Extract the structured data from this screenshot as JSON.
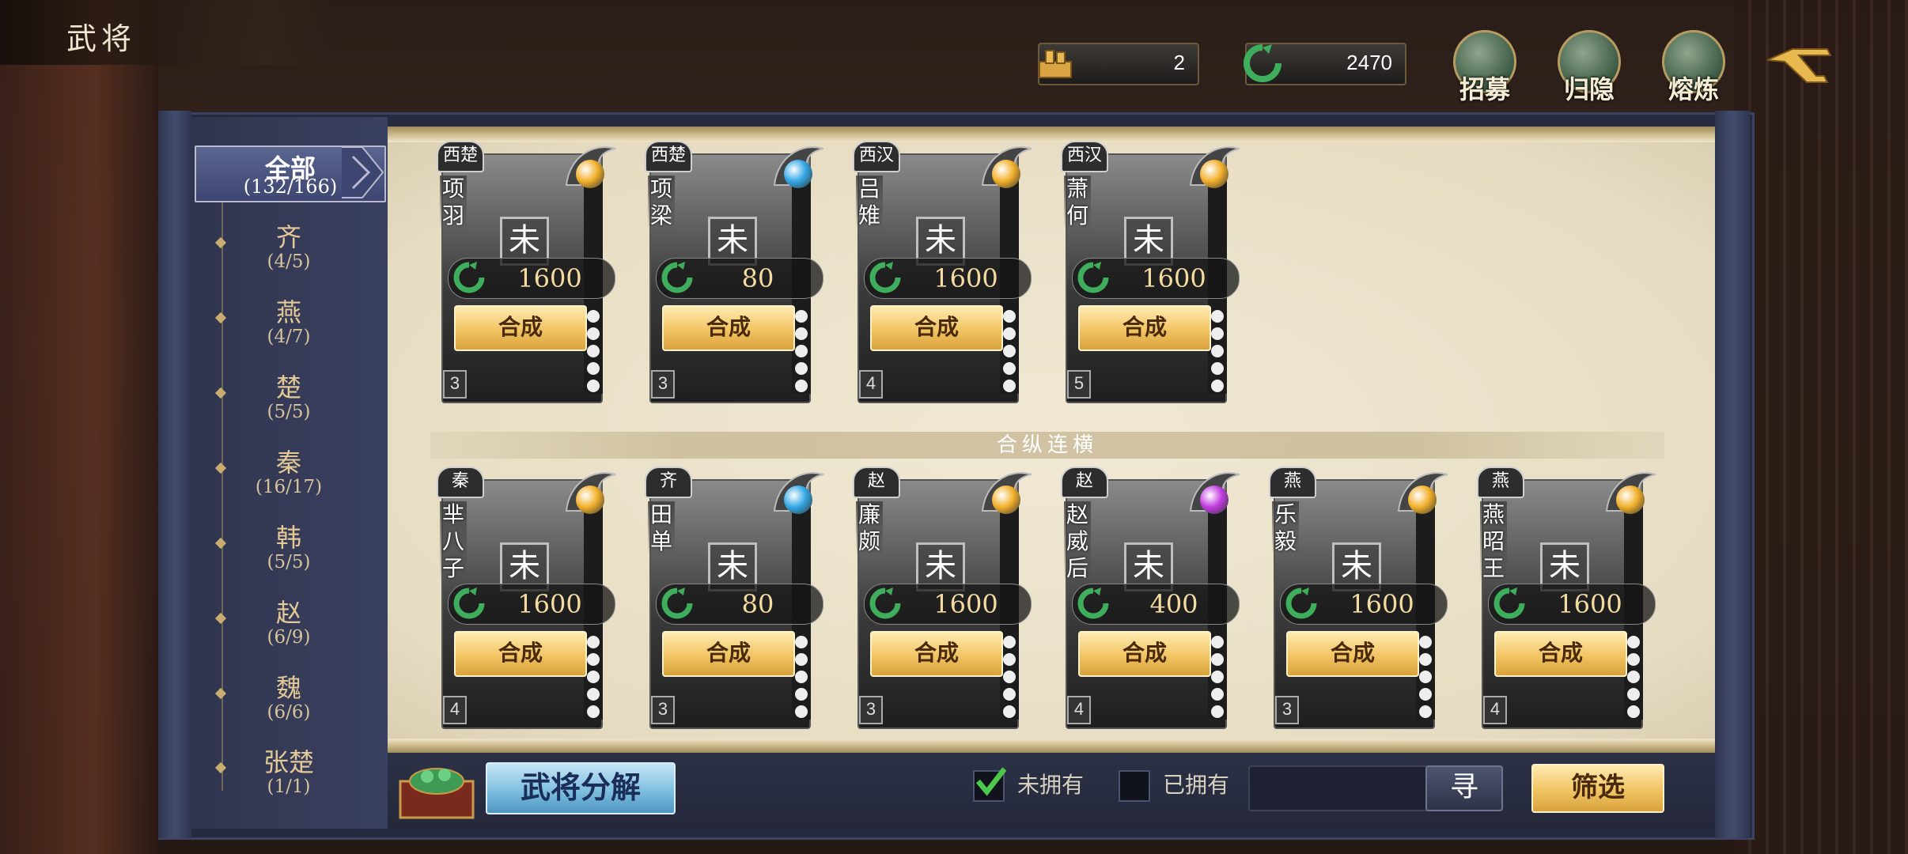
{
  "header": {
    "title": "武将"
  },
  "currency": [
    {
      "icon": "gold-ingot-icon",
      "value": "2"
    },
    {
      "icon": "jade-coin-icon",
      "value": "2470"
    }
  ],
  "top_buttons": [
    {
      "label": "招募",
      "icon": "recruit-icon"
    },
    {
      "label": "归隐",
      "icon": "retire-icon"
    },
    {
      "label": "熔炼",
      "icon": "smelt-icon"
    }
  ],
  "sidebar": {
    "active": {
      "name": "全部",
      "count": "(132/166)"
    },
    "items": [
      {
        "name": "齐",
        "count": "(4/5)"
      },
      {
        "name": "燕",
        "count": "(4/7)"
      },
      {
        "name": "楚",
        "count": "(5/5)"
      },
      {
        "name": "秦",
        "count": "(16/17)"
      },
      {
        "name": "韩",
        "count": "(5/5)"
      },
      {
        "name": "赵",
        "count": "(6/9)"
      },
      {
        "name": "魏",
        "count": "(6/6)"
      },
      {
        "name": "张楚",
        "count": "(1/1)"
      }
    ]
  },
  "status_char": "未",
  "synth_label": "合成",
  "divider_label": "合纵连横",
  "heroes_row1": [
    {
      "faction": "西楚",
      "name": "项羽",
      "cost": "1600",
      "level": "3",
      "orb": "#f2b02a"
    },
    {
      "faction": "西楚",
      "name": "项梁",
      "cost": "80",
      "level": "3",
      "orb": "#33a8e6"
    },
    {
      "faction": "西汉",
      "name": "吕雉",
      "cost": "1600",
      "level": "4",
      "orb": "#f2b02a"
    },
    {
      "faction": "西汉",
      "name": "萧何",
      "cost": "1600",
      "level": "5",
      "orb": "#f2b02a"
    }
  ],
  "heroes_row2": [
    {
      "faction": "秦",
      "name": "芈八子",
      "cost": "1600",
      "level": "4",
      "orb": "#f2b02a"
    },
    {
      "faction": "齐",
      "name": "田单",
      "cost": "80",
      "level": "3",
      "orb": "#33a8e6"
    },
    {
      "faction": "赵",
      "name": "廉颇",
      "cost": "1600",
      "level": "3",
      "orb": "#f2b02a"
    },
    {
      "faction": "赵",
      "name": "赵威后",
      "cost": "400",
      "level": "4",
      "orb": "#c23ce0"
    },
    {
      "faction": "燕",
      "name": "乐毅",
      "cost": "1600",
      "level": "3",
      "orb": "#f2b02a"
    },
    {
      "faction": "燕",
      "name": "燕昭王",
      "cost": "1600",
      "level": "4",
      "orb": "#f2b02a"
    }
  ],
  "bottom": {
    "decompose_label": "武将分解",
    "not_owned_label": "未拥有",
    "owned_label": "已拥有",
    "not_owned_checked": true,
    "owned_checked": false,
    "search_value": "",
    "search_label": "寻",
    "filter_label": "筛选"
  }
}
